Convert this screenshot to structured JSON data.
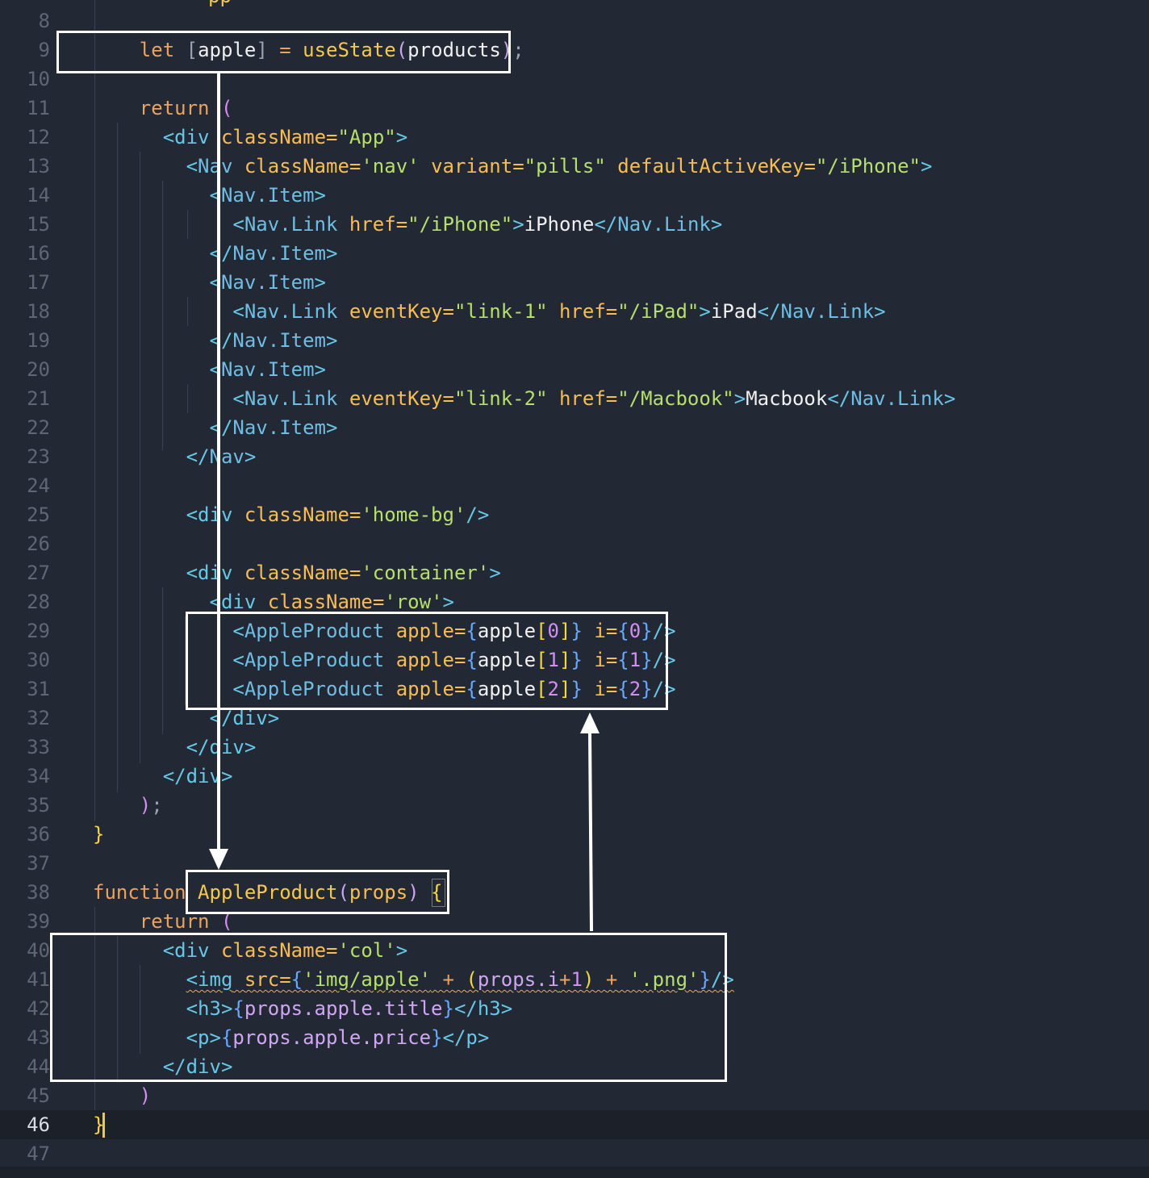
{
  "editor": {
    "current_line": "46",
    "lines": {
      "l8": {
        "num": "8",
        "top_fragment": "pp"
      },
      "l9": {
        "num": "9"
      },
      "l10": {
        "num": "10"
      },
      "l11": {
        "num": "11"
      },
      "l12": {
        "num": "12"
      },
      "l13": {
        "num": "13"
      },
      "l14": {
        "num": "14"
      },
      "l15": {
        "num": "15"
      },
      "l16": {
        "num": "16"
      },
      "l17": {
        "num": "17"
      },
      "l18": {
        "num": "18"
      },
      "l19": {
        "num": "19"
      },
      "l20": {
        "num": "20"
      },
      "l21": {
        "num": "21"
      },
      "l22": {
        "num": "22"
      },
      "l23": {
        "num": "23"
      },
      "l24": {
        "num": "24"
      },
      "l25": {
        "num": "25"
      },
      "l26": {
        "num": "26"
      },
      "l27": {
        "num": "27"
      },
      "l28": {
        "num": "28"
      },
      "l29": {
        "num": "29"
      },
      "l30": {
        "num": "30"
      },
      "l31": {
        "num": "31"
      },
      "l32": {
        "num": "32"
      },
      "l33": {
        "num": "33"
      },
      "l34": {
        "num": "34"
      },
      "l35": {
        "num": "35"
      },
      "l36": {
        "num": "36"
      },
      "l37": {
        "num": "37"
      },
      "l38": {
        "num": "38"
      },
      "l39": {
        "num": "39"
      },
      "l40": {
        "num": "40"
      },
      "l41": {
        "num": "41"
      },
      "l42": {
        "num": "42"
      },
      "l43": {
        "num": "43"
      },
      "l44": {
        "num": "44"
      },
      "l45": {
        "num": "45"
      },
      "l46": {
        "num": "46"
      },
      "l47": {
        "num": "47"
      }
    },
    "tokens": {
      "let": "let",
      "apple": "apple",
      "useState": "useState",
      "products": "products",
      "return": "return",
      "function": "function",
      "AppleProduct": "AppleProduct",
      "props": "props",
      "div": "div",
      "className": "className",
      "Nav": "Nav",
      "NavItem": "Nav.Item",
      "NavLink": "Nav.Link",
      "variant": "variant",
      "defaultActiveKey": "defaultActiveKey",
      "href": "href",
      "eventKey": "eventKey",
      "i": "i",
      "img": "img",
      "src": "src",
      "h3": "h3",
      "p": "p",
      "str_App": "\"App\"",
      "str_nav": "'nav'",
      "str_pills": "\"pills\"",
      "str_iPhone_path": "\"/iPhone\"",
      "str_link1": "\"link-1\"",
      "str_iPad_path": "\"/iPad\"",
      "str_link2": "\"link-2\"",
      "str_Macbook_path": "\"/Macbook\"",
      "str_homebg": "'home-bg'",
      "str_container": "'container'",
      "str_row": "'row'",
      "str_col": "'col'",
      "str_imgapple": "'img/apple'",
      "str_png": "'.png'",
      "txt_iPhone": "iPhone",
      "txt_iPad": "iPad",
      "txt_Macbook": "Macbook",
      "n0": "0",
      "n1": "1",
      "n2": "2",
      "props_i": "props.i",
      "props_apple_title": "props.apple.title",
      "props_apple_price": "props.apple.price"
    }
  },
  "colors": {
    "background": "#222834",
    "keyword": "#e9a35f",
    "string": "#b7df6c",
    "tag": "#66c8e6",
    "attribute": "#f6bd55",
    "annotation": "#ffffff"
  }
}
